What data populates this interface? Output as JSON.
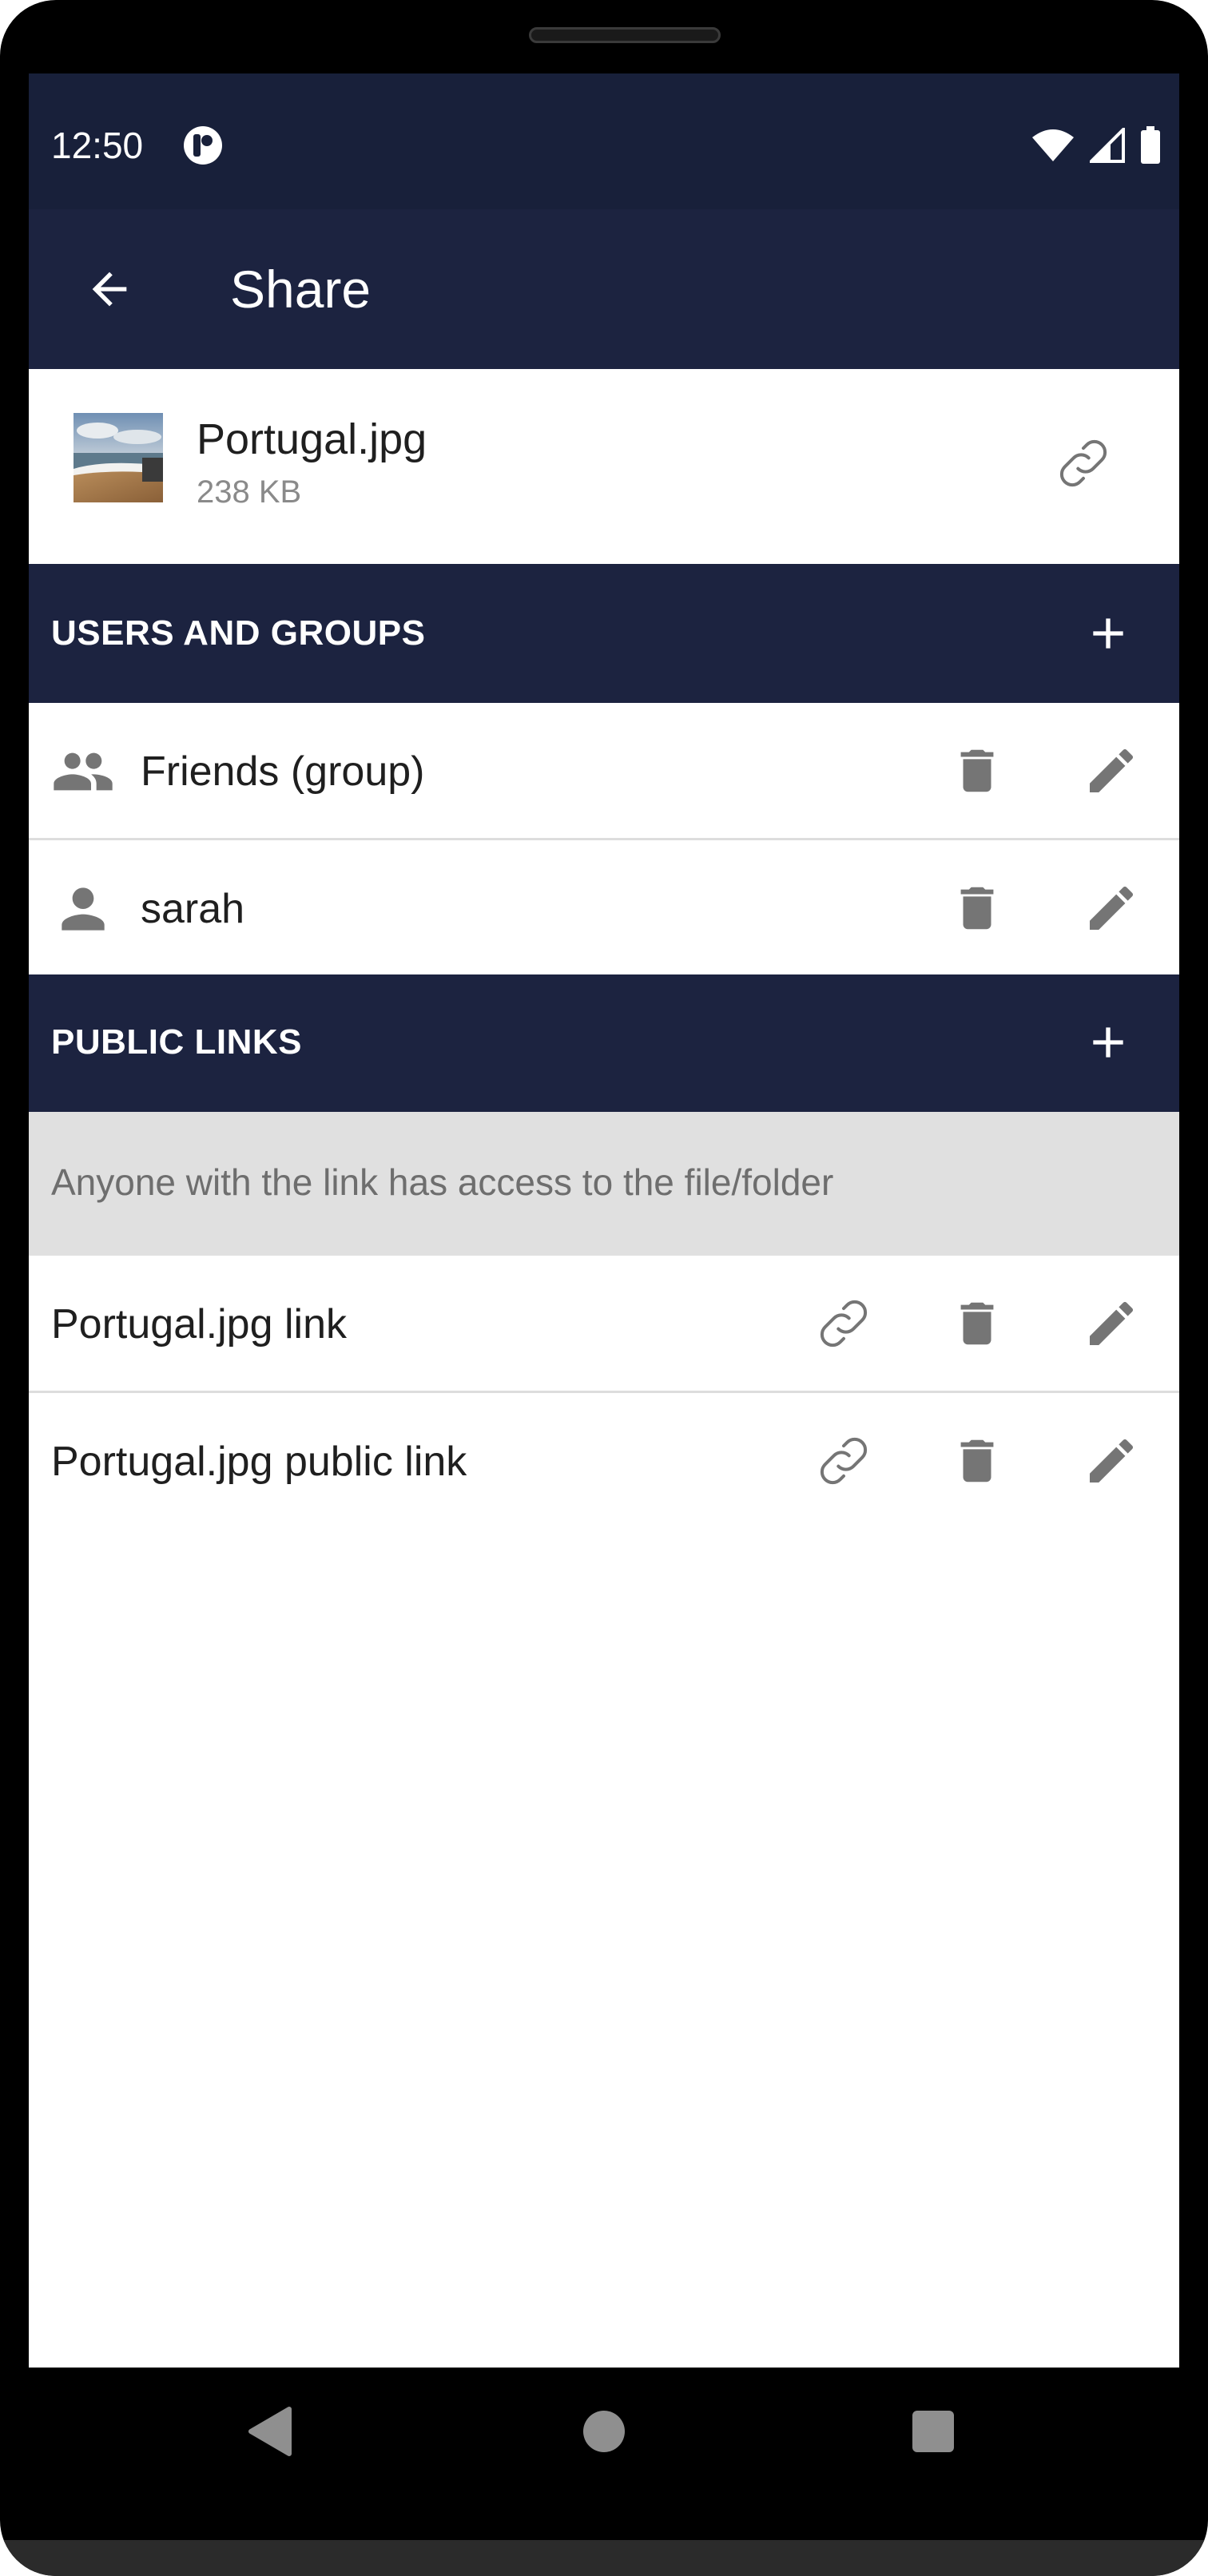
{
  "status_bar": {
    "time": "12:50",
    "icons": [
      "app-notification-icon",
      "wifi-icon",
      "signal-icon",
      "battery-icon"
    ]
  },
  "app_bar": {
    "title": "Share",
    "back_icon": "arrow-back-icon"
  },
  "file": {
    "name": "Portugal.jpg",
    "size": "238 KB",
    "link_icon": "link-icon"
  },
  "users_and_groups": {
    "title": "USERS AND GROUPS",
    "add_icon": "plus-icon",
    "items": [
      {
        "label": "Friends (group)",
        "icon": "group-icon"
      },
      {
        "label": "sarah",
        "icon": "person-icon"
      }
    ]
  },
  "public_links": {
    "title": "PUBLIC LINKS",
    "add_icon": "plus-icon",
    "info": "Anyone with the link has access to the file/folder",
    "items": [
      {
        "label": "Portugal.jpg link"
      },
      {
        "label": "Portugal.jpg public link"
      }
    ]
  },
  "colors": {
    "primary_dark": "#1c2340",
    "status_bar": "#18203a",
    "icon_gray": "#757575",
    "divider": "#dddddd",
    "info_bg": "#e0e0e0"
  }
}
